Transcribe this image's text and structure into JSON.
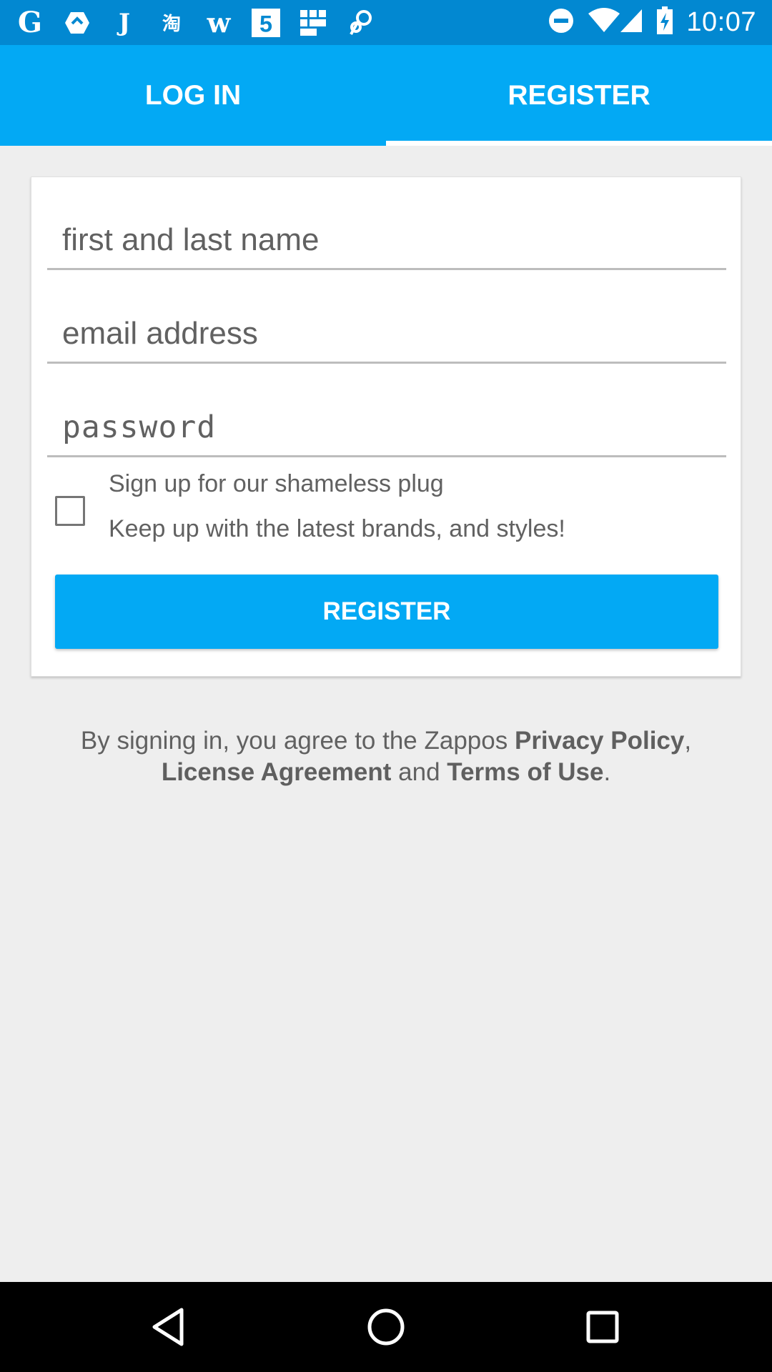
{
  "status_bar": {
    "time": "10:07",
    "notification_icons": [
      "google-icon",
      "inbox-icon",
      "j-app-icon",
      "taobao-icon",
      "w-app-icon",
      "five-app-icon",
      "grid-app-icon",
      "link-app-icon"
    ],
    "system_icons": [
      "do-not-disturb-icon",
      "wifi-icon",
      "signal-icon",
      "battery-charging-icon"
    ]
  },
  "tabs": [
    {
      "label": "LOG IN",
      "selected": false
    },
    {
      "label": "REGISTER",
      "selected": true
    }
  ],
  "form": {
    "name_placeholder": "first and last name",
    "email_placeholder": "email address",
    "password_placeholder": "password",
    "newsletter_title": "Sign up for our shameless plug",
    "newsletter_subtitle": "Keep up with the latest brands, and styles!",
    "newsletter_checked": false,
    "register_button": "REGISTER"
  },
  "legal": {
    "prefix": "By signing in, you agree to the Zappos ",
    "privacy_policy": "Privacy Policy",
    "comma": ",",
    "license_agreement": "License Agreement",
    "and": " and ",
    "terms_of_use": "Terms of Use",
    "period": "."
  },
  "nav_bar": {
    "icons": [
      "back-icon",
      "home-icon",
      "recents-icon"
    ]
  },
  "colors": {
    "status_bar": "#0288d1",
    "accent": "#03a9f4",
    "background": "#eeeeee"
  }
}
